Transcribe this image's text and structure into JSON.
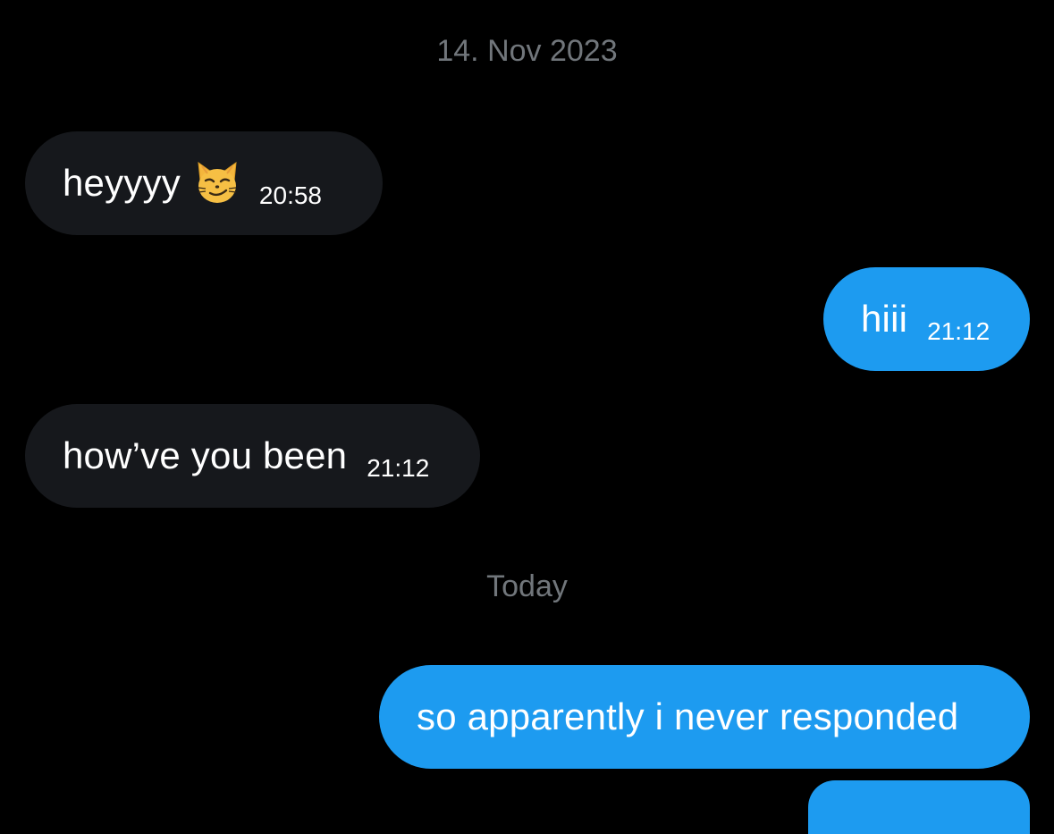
{
  "conversation": {
    "separators": [
      {
        "label": "14. Nov 2023"
      },
      {
        "label": "Today"
      }
    ],
    "messages": [
      {
        "direction": "incoming",
        "text": "heyyyy",
        "icon": "smirking-cat-icon",
        "time": "20:58"
      },
      {
        "direction": "outgoing",
        "text": "hiii",
        "time": "21:12"
      },
      {
        "direction": "incoming",
        "text": "how’ve you been",
        "time": "21:12"
      },
      {
        "direction": "outgoing",
        "text": "so apparently i never responded",
        "time": ""
      }
    ]
  },
  "colors": {
    "background": "#000000",
    "incoming_bubble": "#16181c",
    "outgoing_bubble": "#1d9bf0",
    "separator_text": "#71767b",
    "message_text": "#ffffff"
  }
}
